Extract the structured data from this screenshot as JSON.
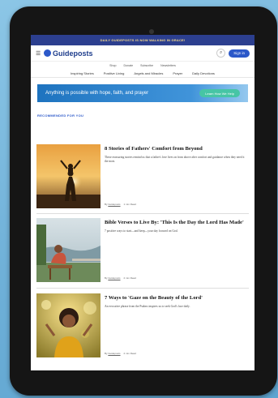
{
  "promo_bar": "DAILY GUIDEPOSTS IS NOW WALKING IN GRACE!",
  "header": {
    "brand": "Guideposts",
    "signin_label": "Sign in",
    "utility_nav": [
      "Shop",
      "Donate",
      "Subscribe",
      "Newsletters"
    ],
    "main_nav": [
      "Inspiring Stories",
      "Positive Living",
      "Angels and Miracles",
      "Prayer",
      "Daily Devotions"
    ]
  },
  "banner": {
    "text": "Anything is possible with hope, faith, and prayer",
    "button": "Learn How We Help"
  },
  "section_label": "RECOMMENDED FOR YOU",
  "articles": [
    {
      "title": "8 Stories of Fathers' Comfort from Beyond",
      "desc": "These reassuring stories remind us that a father's love lives on from above after comfort and guidance when they need it the most.",
      "author": "Guideposts",
      "read_time": "1 min Read"
    },
    {
      "title": "Bible Verses to Live By: 'This Is the Day the Lord Has Made'",
      "desc": "7 positive ways to start—and keep—your day focused on God.",
      "author": "Guideposts",
      "read_time": "2 min Read"
    },
    {
      "title": "7 Ways to 'Gaze on the Beauty of the Lord'",
      "desc": "An evocative phrase from the Psalms inspires us to seek God's face daily.",
      "author": "Guideposts",
      "read_time": "2 min Read"
    }
  ],
  "colors": {
    "promo_bg": "#2c3f8f",
    "brand_blue": "#2b58c9",
    "banner_button": "#47c5a5"
  },
  "icons": {
    "menu": "hamburger-icon",
    "search": "search-icon",
    "logo": "guideposts-logo"
  }
}
